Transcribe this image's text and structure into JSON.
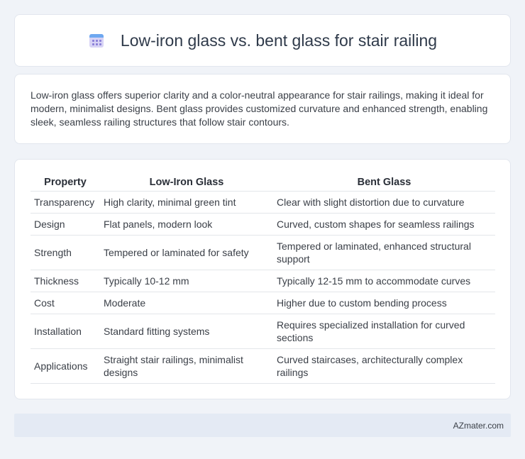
{
  "header": {
    "title": "Low-iron glass vs. bent glass for stair railing",
    "icon": "calendar-icon"
  },
  "intro": {
    "text": "Low-iron glass offers superior clarity and a color-neutral appearance for stair railings, making it ideal for modern, minimalist designs. Bent glass provides customized curvature and enhanced strength, enabling sleek, seamless railing structures that follow stair contours."
  },
  "table": {
    "headers": [
      "Property",
      "Low-Iron Glass",
      "Bent Glass"
    ],
    "rows": [
      [
        "Transparency",
        "High clarity, minimal green tint",
        "Clear with slight distortion due to curvature"
      ],
      [
        "Design",
        "Flat panels, modern look",
        "Curved, custom shapes for seamless railings"
      ],
      [
        "Strength",
        "Tempered or laminated for safety",
        "Tempered or laminated, enhanced structural support"
      ],
      [
        "Thickness",
        "Typically 10-12 mm",
        "Typically 12-15 mm to accommodate curves"
      ],
      [
        "Cost",
        "Moderate",
        "Higher due to custom bending process"
      ],
      [
        "Installation",
        "Standard fitting systems",
        "Requires specialized installation for curved sections"
      ],
      [
        "Applications",
        "Straight stair railings, minimalist designs",
        "Curved staircases, architecturally complex railings"
      ]
    ]
  },
  "footer": {
    "brand": "AZmater.com"
  }
}
